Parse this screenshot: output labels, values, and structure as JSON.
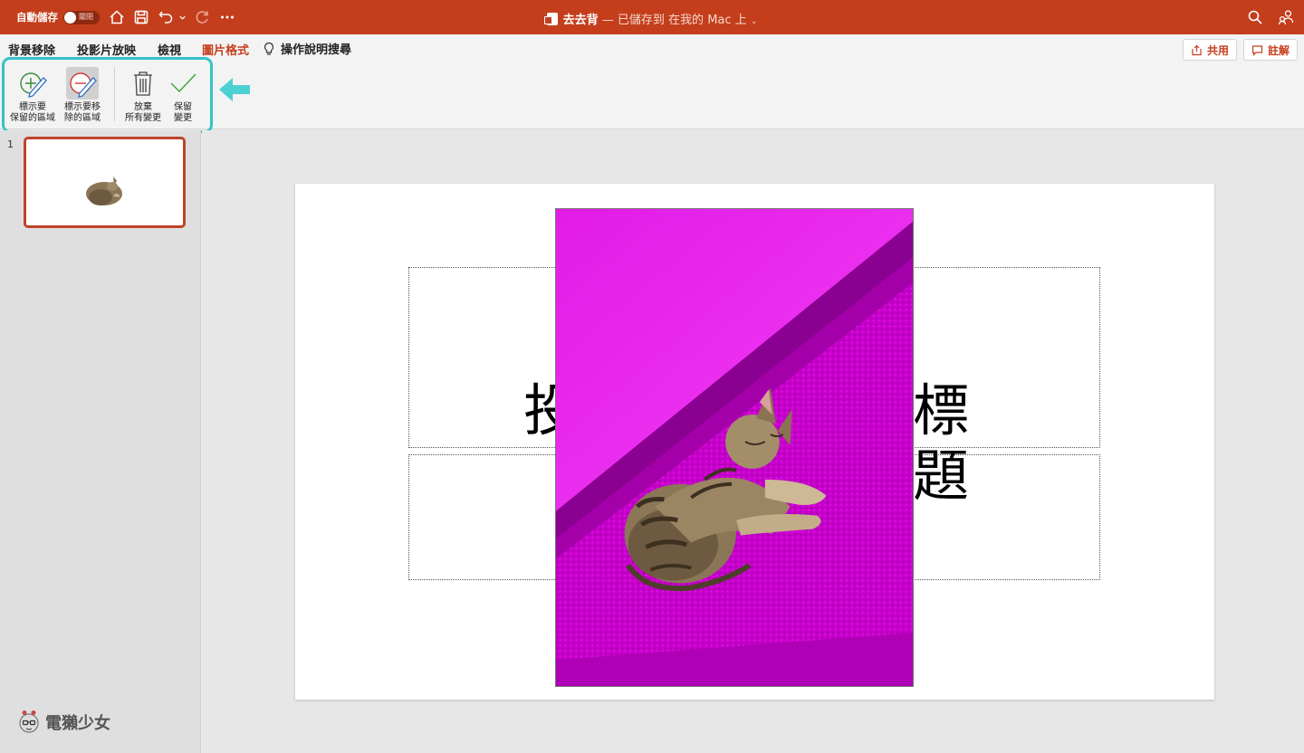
{
  "titlebar": {
    "autosave_label": "自動儲存",
    "autosave_toggle": "關閉",
    "doc_name": "去去背",
    "save_status": "— 已儲存到 在我的 Mac 上",
    "icons": [
      "home-icon",
      "save-icon",
      "undo-icon",
      "redo-icon",
      "more-icon",
      "search-icon",
      "share-people-icon"
    ]
  },
  "menu": {
    "tabs": [
      "背景移除",
      "投影片放映",
      "檢視",
      "圖片格式"
    ],
    "active_tab": "圖片格式",
    "tell_me": "操作說明搜尋",
    "share_label": "共用",
    "comment_label": "註解"
  },
  "ribbon": {
    "mark_keep": [
      "標示要",
      "保留的區域"
    ],
    "mark_remove": [
      "標示要移",
      "除的區域"
    ],
    "discard": [
      "放棄",
      "所有變更"
    ],
    "keep_changes": [
      "保留",
      "變更"
    ]
  },
  "slides": {
    "current_number": "1"
  },
  "slide": {
    "title_left": "投",
    "title_right": "標題"
  },
  "watermark": {
    "text": "電獺少女"
  },
  "colors": {
    "accent": "#c43e1c",
    "highlight": "#35c3c8",
    "removal_overlay": "#e000e6"
  }
}
